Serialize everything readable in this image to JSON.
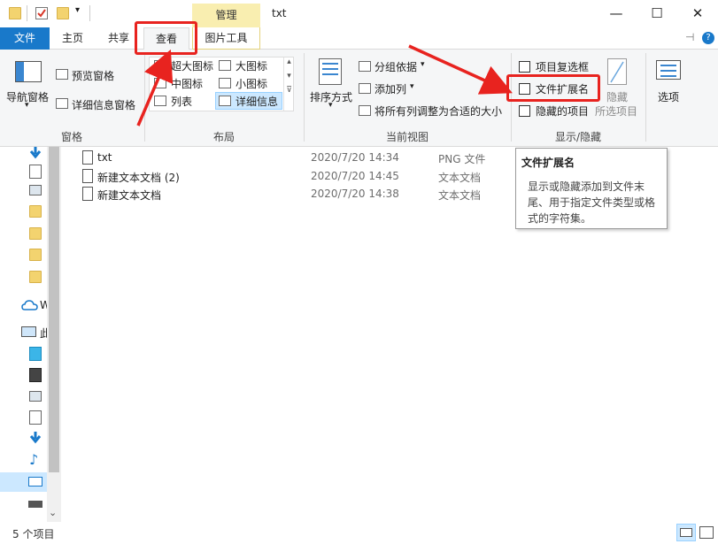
{
  "window": {
    "title": "txt",
    "context_tab": "管理",
    "minimize": "—",
    "maximize": "☐",
    "close": "✕"
  },
  "tabs": {
    "file": "文件",
    "home": "主页",
    "share": "共享",
    "view": "查看",
    "picture_tools": "图片工具",
    "pin_icon": "⊣",
    "help_icon": "?"
  },
  "ribbon": {
    "pane": {
      "label": "窗格",
      "nav_pane": "导航窗格",
      "nav_pane_arrow": "▾",
      "preview_pane": "预览窗格",
      "details_pane": "详细信息窗格"
    },
    "layout": {
      "label": "布局",
      "extra_large": "超大图标",
      "large": "大图标",
      "medium": "中图标",
      "small": "小图标",
      "list": "列表",
      "details": "详细信息",
      "scroll_up": "▴",
      "scroll_down": "▾",
      "more": "⊽"
    },
    "current_view": {
      "label": "当前视图",
      "sort_by": "排序方式",
      "sort_arrow": "▾",
      "group_by": "分组依据",
      "group_arrow": "▾",
      "add_column": "添加列",
      "add_arrow": "▾",
      "fit_columns": "将所有列调整为合适的大小"
    },
    "show_hide": {
      "label": "显示/隐藏",
      "item_checkboxes": "项目复选框",
      "file_extensions": "文件扩展名",
      "hidden_items": "隐藏的项目",
      "hide": "隐藏",
      "selected_items": "所选项目"
    },
    "options": "选项"
  },
  "nav": {
    "onedrive_letter": "W",
    "thispc_letter": "此",
    "scroll_down": "⌄"
  },
  "files": [
    {
      "name": "txt",
      "date": "2020/7/20 14:34",
      "type": "PNG 文件"
    },
    {
      "name": "新建文本文档 (2)",
      "date": "2020/7/20 14:45",
      "type": "文本文档"
    },
    {
      "name": "新建文本文档",
      "date": "2020/7/20 14:38",
      "type": "文本文档"
    }
  ],
  "tooltip": {
    "title": "文件扩展名",
    "line1": "显示或隐藏添加到文件末",
    "line2": "尾、用于指定文件类型或格",
    "line3": "式的字符集。"
  },
  "status": {
    "count": "5 个项目"
  },
  "colors": {
    "accent": "#1979ca",
    "annotation": "#e8231f",
    "context_tab": "#f9eeb0",
    "selection": "#cce8ff"
  }
}
